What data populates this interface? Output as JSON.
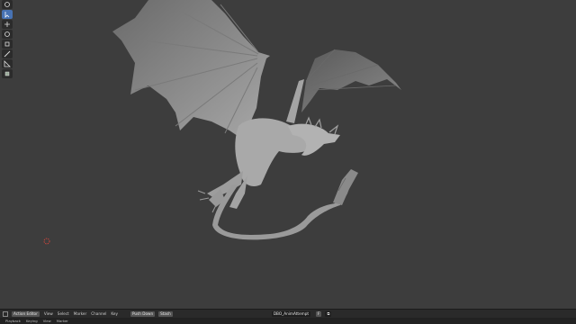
{
  "viewport": {
    "tools": [
      "cursor-icon",
      "move-icon",
      "select-box-icon",
      "scale-icon",
      "transform-icon",
      "annotate-icon",
      "measure-icon",
      "add-cube-icon"
    ]
  },
  "timeline_header": {
    "editor_label": "Action Editor",
    "menus": [
      "View",
      "Select",
      "Marker",
      "Channel",
      "Key"
    ],
    "push_down": "Push Down",
    "stash": "Stash",
    "action_name": "DBO_AnimAttempt"
  },
  "statusbar": {
    "items": [
      "Playback",
      "Keying",
      "View",
      "Marker"
    ]
  },
  "colors": {
    "viewport_bg": "#3d3d3d",
    "active_tool": "#4772b3",
    "header_bg": "#2a2a2a"
  }
}
